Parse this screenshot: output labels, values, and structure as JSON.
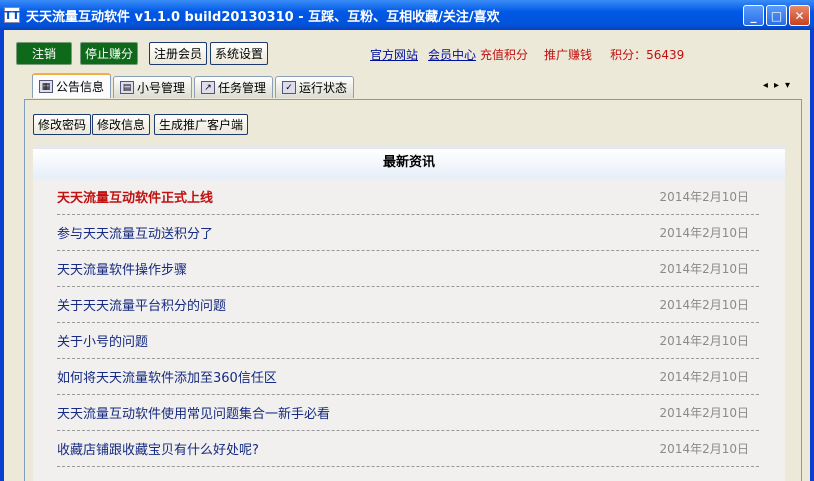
{
  "window": {
    "title": "天天流量互动软件 v1.1.0 build20130310 - 互踩、互粉、互相收藏/关注/喜欢",
    "icon_text": "TT"
  },
  "toolbar": {
    "logout": "注销",
    "stop": "停止赚分",
    "register": "注册会员",
    "settings": "系统设置"
  },
  "links": {
    "official": "官方网站",
    "member": "会员中心",
    "recharge": "充值积分",
    "promote": "推广赚钱",
    "points": "积分：56439"
  },
  "tabs": [
    "公告信息",
    "小号管理",
    "任务管理",
    "运行状态"
  ],
  "sub_buttons": [
    "修改密码",
    "修改信息",
    "生成推广客户端"
  ],
  "news": {
    "title": "最新资讯",
    "items": [
      {
        "title": "天天流量互动软件正式上线",
        "date": "2014年2月10日"
      },
      {
        "title": "参与天天流量互动送积分了",
        "date": "2014年2月10日"
      },
      {
        "title": "天天流量软件操作步骤",
        "date": "2014年2月10日"
      },
      {
        "title": "关于天天流量平台积分的问题",
        "date": "2014年2月10日"
      },
      {
        "title": "关于小号的问题",
        "date": "2014年2月10日"
      },
      {
        "title": "如何将天天流量软件添加至360信任区",
        "date": "2014年2月10日"
      },
      {
        "title": "天天流量互动软件使用常见问题集合一新手必看",
        "date": "2014年2月10日"
      },
      {
        "title": "收藏店铺跟收藏宝贝有什么好处呢?",
        "date": "2014年2月10日"
      },
      {
        "title": "",
        "date": ""
      }
    ]
  }
}
